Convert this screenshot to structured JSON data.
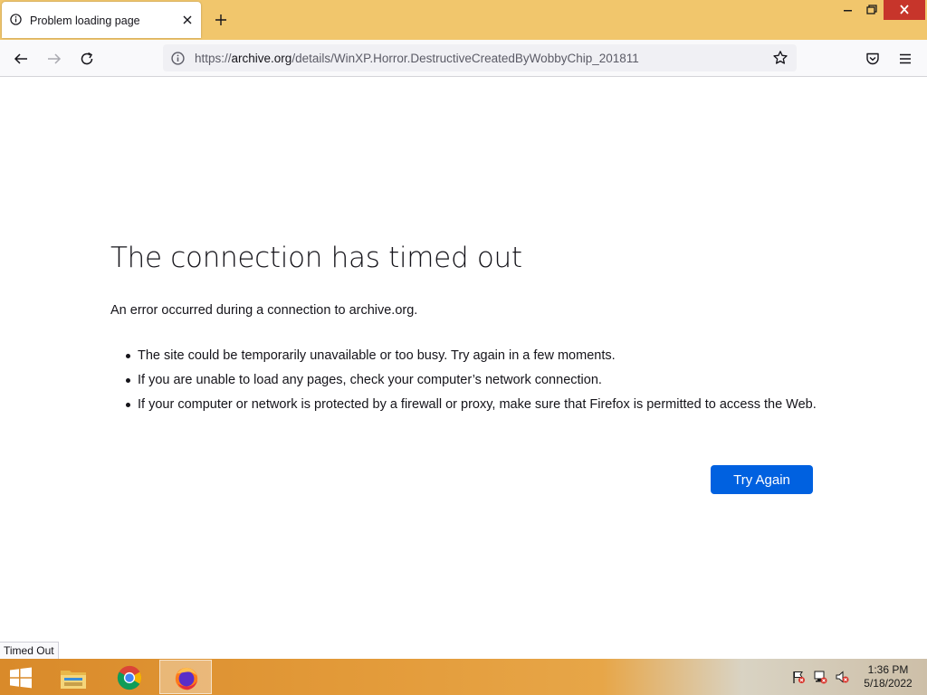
{
  "tab": {
    "title": "Problem loading page"
  },
  "urlbar": {
    "prefix": "https://",
    "host": "archive.org",
    "path": "/details/WinXP.Horror.DestructiveCreatedByWobbyChip_201811"
  },
  "error": {
    "title": "The connection has timed out",
    "description": "An error occurred during a connection to archive.org.",
    "bullets": [
      "The site could be temporarily unavailable or too busy. Try again in a few moments.",
      "If you are unable to load any pages, check your computer’s network connection.",
      "If your computer or network is protected by a firewall or proxy, make sure that Firefox is permitted to access the Web."
    ],
    "try_again_label": "Try Again"
  },
  "status_text": "Timed Out",
  "taskbar": {
    "apps": [
      "file-explorer-icon",
      "chrome-icon",
      "firefox-icon"
    ],
    "tray_icons": [
      "action-center-flag-icon",
      "network-icon",
      "volume-muted-icon"
    ],
    "clock_time": "1:36 PM",
    "clock_date": "5/18/2022"
  },
  "colors": {
    "titlebar": "#f1c66c",
    "accent_button": "#0061e0",
    "close_button": "#c7352b"
  }
}
